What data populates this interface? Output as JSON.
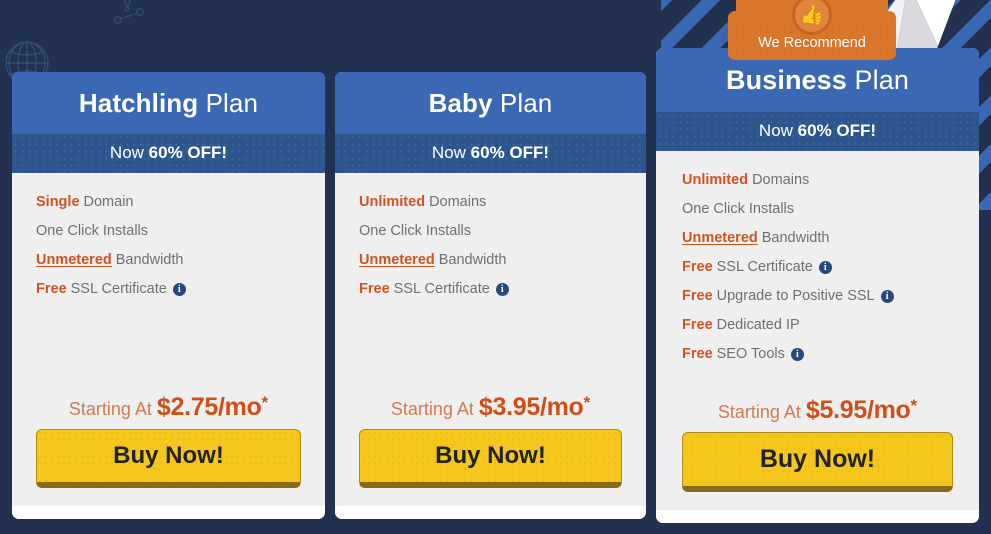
{
  "theme": {
    "page_bg": "#22314f",
    "card_header_blue": "#3b68b4",
    "card_sale_blue": "#2d568f",
    "card_body_gray": "#efefef",
    "accent_orange": "#cf5421",
    "price_orange": "#cf4f16",
    "button_yellow": "#f5c71d",
    "button_shadow": "#8a6a12",
    "badge_orange": "#d9762a",
    "info_icon_blue": "#27497f",
    "feature_text_gray": "#6d7076"
  },
  "recommend_badge": {
    "label": "We Recommend",
    "icon": "thumbs-up-icon",
    "glyph": "👍"
  },
  "decorations": [
    {
      "name": "globe-wireframe-icon"
    },
    {
      "name": "network-node-icon"
    },
    {
      "name": "diagonal-stripes-pattern"
    },
    {
      "name": "origami-paper-plane-icon"
    }
  ],
  "plans": [
    {
      "id": "hatchling",
      "name_bold": "Hatchling",
      "name_light": "Plan",
      "sale_prefix": "Now",
      "sale_bold": "60% OFF!",
      "features": [
        {
          "highlight": "Single",
          "underline": false,
          "text": "Domain",
          "info": false
        },
        {
          "highlight": "",
          "underline": false,
          "text": "One Click Installs",
          "info": false
        },
        {
          "highlight": "Unmetered",
          "underline": true,
          "text": "Bandwidth",
          "info": false
        },
        {
          "highlight": "Free",
          "underline": false,
          "text": "SSL Certificate",
          "info": true
        }
      ],
      "price_prefix": "Starting At",
      "price": "$2.75/mo",
      "price_star": "*",
      "cta": "Buy Now!"
    },
    {
      "id": "baby",
      "name_bold": "Baby",
      "name_light": "Plan",
      "sale_prefix": "Now",
      "sale_bold": "60% OFF!",
      "features": [
        {
          "highlight": "Unlimited",
          "underline": false,
          "text": "Domains",
          "info": false
        },
        {
          "highlight": "",
          "underline": false,
          "text": "One Click Installs",
          "info": false
        },
        {
          "highlight": "Unmetered",
          "underline": true,
          "text": "Bandwidth",
          "info": false
        },
        {
          "highlight": "Free",
          "underline": false,
          "text": "SSL Certificate",
          "info": true
        }
      ],
      "price_prefix": "Starting At",
      "price": "$3.95/mo",
      "price_star": "*",
      "cta": "Buy Now!"
    },
    {
      "id": "business",
      "name_bold": "Business",
      "name_light": "Plan",
      "sale_prefix": "Now",
      "sale_bold": "60% OFF!",
      "features": [
        {
          "highlight": "Unlimited",
          "underline": false,
          "text": "Domains",
          "info": false
        },
        {
          "highlight": "",
          "underline": false,
          "text": "One Click Installs",
          "info": false
        },
        {
          "highlight": "Unmetered",
          "underline": true,
          "text": "Bandwidth",
          "info": false
        },
        {
          "highlight": "Free",
          "underline": false,
          "text": "SSL Certificate",
          "info": true
        },
        {
          "highlight": "Free",
          "underline": false,
          "text": "Upgrade to Positive SSL",
          "info": true
        },
        {
          "highlight": "Free",
          "underline": false,
          "text": "Dedicated IP",
          "info": false
        },
        {
          "highlight": "Free",
          "underline": false,
          "text": "SEO Tools",
          "info": true
        }
      ],
      "price_prefix": "Starting At",
      "price": "$5.95/mo",
      "price_star": "*",
      "cta": "Buy Now!"
    }
  ]
}
